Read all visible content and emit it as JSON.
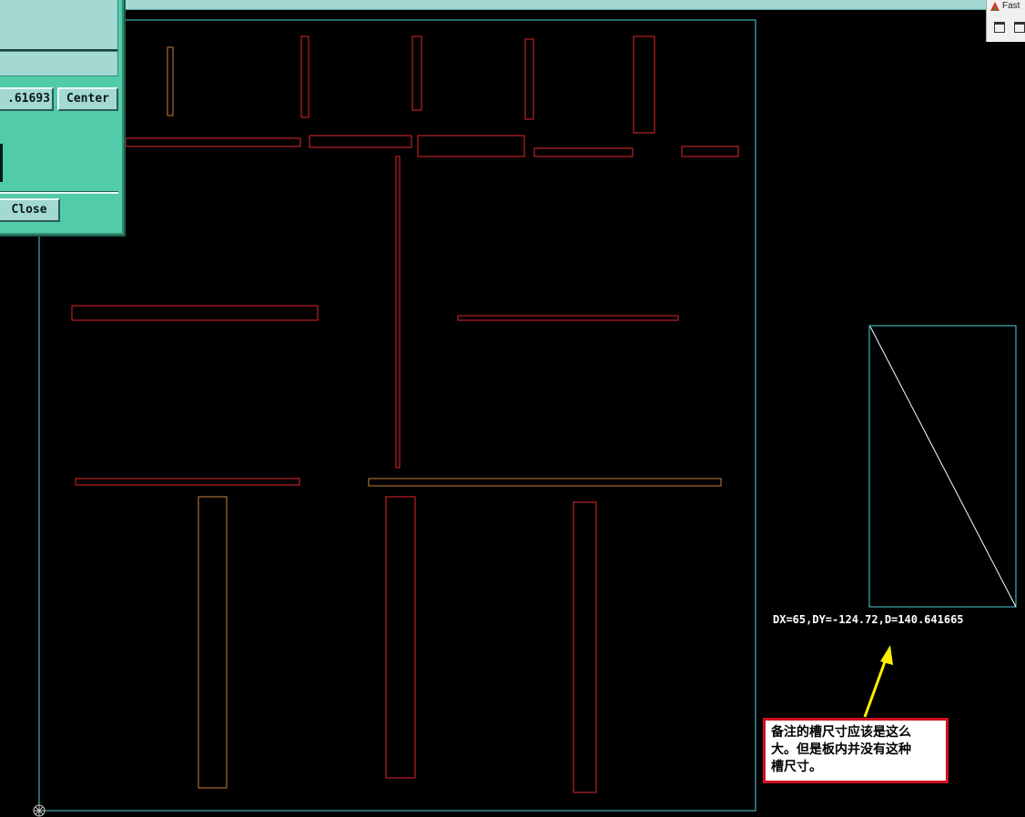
{
  "dialog": {
    "value_text": ".61693",
    "center_label": "Center",
    "close_label": "Close"
  },
  "app_window": {
    "title_fragment": "Fast"
  },
  "measurement": {
    "text": "DX=65,DY=-124.72,D=140.641665"
  },
  "note": {
    "lines": [
      "备注的槽尺寸应该是这么",
      "大。但是板内并没有这种",
      "槽尺寸。"
    ]
  },
  "colors": {
    "background": "#000000",
    "board_outline": "#4fd2d8",
    "slot_red": "#e2262a",
    "slot_orange": "#c8823a",
    "measure_line": "#ffffff",
    "arrow_yellow": "#ffee00",
    "note_border": "#d01020",
    "dialog_bg": "#52cca8"
  }
}
